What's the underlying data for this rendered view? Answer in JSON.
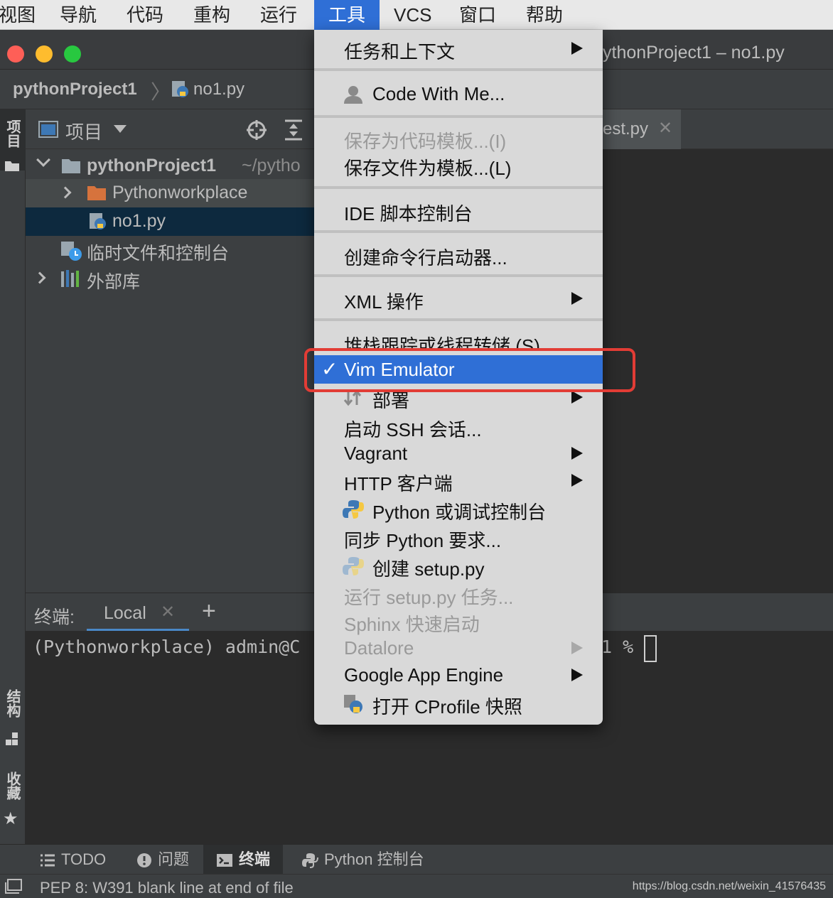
{
  "menubar": {
    "items": [
      "视图",
      "导航",
      "代码",
      "重构",
      "运行",
      "工具",
      "VCS",
      "窗口",
      "帮助"
    ],
    "active_index": 5
  },
  "window": {
    "title": "ythonProject1 – no1.py"
  },
  "breadcrumb": {
    "project": "pythonProject1",
    "file": "no1.py"
  },
  "left_strip": {
    "top_label": "项目",
    "structure_label": "结构",
    "favorites_label": "收藏"
  },
  "project_panel": {
    "title": "项目",
    "tree": [
      {
        "label": "pythonProject1",
        "suffix": "~/pytho",
        "type": "project-root",
        "expanded": true
      },
      {
        "label": "Pythonworkplace",
        "type": "folder",
        "expanded": false
      },
      {
        "label": "no1.py",
        "type": "python-file",
        "selected": true
      },
      {
        "label": "临时文件和控制台",
        "type": "scratches"
      },
      {
        "label": "外部库",
        "type": "libraries",
        "expanded": false
      }
    ]
  },
  "editor": {
    "tab_fragment": "est.py"
  },
  "terminal": {
    "label": "终端:",
    "tab": "Local",
    "prompt": "(Pythonworkplace) admin@C",
    "prompt_tail": "1 %"
  },
  "dropdown": {
    "items": [
      {
        "label": "任务和上下文",
        "submenu": true
      },
      {
        "label": "Code With Me...",
        "icon": "person-icon"
      },
      {
        "label": "保存为代码模板...(I)",
        "disabled": true
      },
      {
        "label": "保存文件为模板...(L)"
      },
      {
        "label": "IDE 脚本控制台"
      },
      {
        "label": "创建命令行启动器..."
      },
      {
        "label": "XML 操作",
        "submenu": true
      },
      {
        "label": "堆栈跟踪或线程转储 (S)..."
      },
      {
        "label": "Vim Emulator",
        "checked": true,
        "highlighted": true
      },
      {
        "label": "部署",
        "submenu": true,
        "icon": "deploy-icon"
      },
      {
        "label": "启动 SSH 会话..."
      },
      {
        "label": "Vagrant",
        "submenu": true
      },
      {
        "label": "HTTP 客户端",
        "submenu": true
      },
      {
        "label": "Python 或调试控制台",
        "icon": "python-icon"
      },
      {
        "label": "同步 Python 要求..."
      },
      {
        "label": "创建 setup.py",
        "icon": "python-icon"
      },
      {
        "label": "运行 setup.py 任务...",
        "disabled": true
      },
      {
        "label": "Sphinx 快速启动",
        "disabled": true
      },
      {
        "label": "Datalore",
        "submenu": true,
        "disabled": true
      },
      {
        "label": "Google App Engine",
        "submenu": true
      },
      {
        "label": "打开 CProfile 快照",
        "icon": "cprofile-icon"
      }
    ]
  },
  "bottom_bar": {
    "todo": "TODO",
    "problems": "问题",
    "terminal": "终端",
    "python_console": "Python 控制台"
  },
  "status_bar": {
    "message": "PEP 8: W391 blank line at end of file",
    "watermark": "https://blog.csdn.net/weixin_41576435"
  },
  "colors": {
    "menu_highlight": "#2f6fd6",
    "annotation": "#e23c35",
    "selection": "#0d293e"
  }
}
